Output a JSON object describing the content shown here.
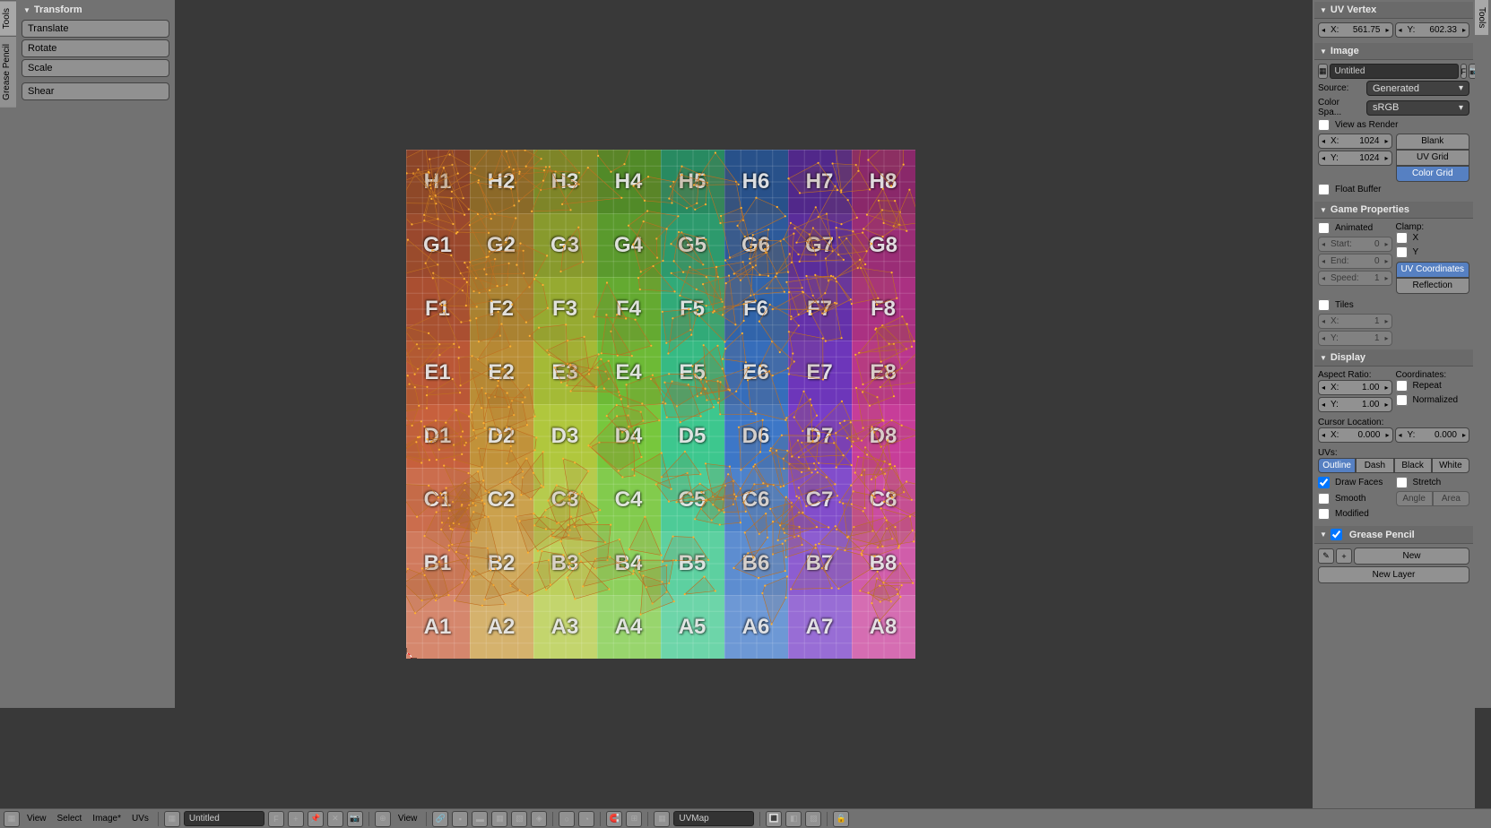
{
  "left_tabs": [
    "Tools",
    "Grease Pencil"
  ],
  "right_tabs": [
    "Tools"
  ],
  "transform": {
    "title": "Transform",
    "buttons": [
      "Translate",
      "Rotate",
      "Scale",
      "Shear"
    ]
  },
  "uv_vertex": {
    "title": "UV Vertex",
    "x": "561.75",
    "y": "602.33"
  },
  "image": {
    "title": "Image",
    "name": "Untitled",
    "f_label": "F",
    "source_label": "Source:",
    "source_value": "Generated",
    "colorspace_label": "Color Spa...",
    "colorspace_value": "sRGB",
    "view_as_render": "View as Render",
    "res_x": "1024",
    "res_y": "1024",
    "gen_types": [
      "Blank",
      "UV Grid",
      "Color Grid"
    ],
    "gen_active": 2,
    "float_buffer": "Float Buffer"
  },
  "game_props": {
    "title": "Game Properties",
    "animated": "Animated",
    "start_label": "Start:",
    "start_value": "0",
    "end_label": "End:",
    "end_value": "0",
    "speed_label": "Speed:",
    "speed_value": "1",
    "clamp_label": "Clamp:",
    "clamp_x": "X",
    "clamp_y": "Y",
    "mapping_types": [
      "UV Coordinates",
      "Reflection"
    ],
    "mapping_active": 0,
    "tiles": "Tiles",
    "tiles_x": "1",
    "tiles_y": "1"
  },
  "display": {
    "title": "Display",
    "aspect_label": "Aspect Ratio:",
    "aspect_x": "1.00",
    "aspect_y": "1.00",
    "coords_label": "Coordinates:",
    "repeat": "Repeat",
    "normalized": "Normalized",
    "cursor_label": "Cursor Location:",
    "cursor_x": "0.000",
    "cursor_y": "0.000",
    "uvs_label": "UVs:",
    "uv_styles": [
      "Outline",
      "Dash",
      "Black",
      "White"
    ],
    "uv_style_active": 0,
    "draw_faces": "Draw Faces",
    "stretch": "Stretch",
    "smooth": "Smooth",
    "stretch_types": [
      "Angle",
      "Area"
    ],
    "modified": "Modified"
  },
  "grease_pencil": {
    "title": "Grease Pencil",
    "new": "New",
    "new_layer": "New Layer"
  },
  "footer": {
    "menus": [
      "View",
      "Select",
      "Image*",
      "UVs"
    ],
    "image_name": "Untitled",
    "f_label": "F",
    "view_label": "View",
    "uv_map": "UVMap"
  },
  "uv_grid": {
    "rows": [
      "H",
      "G",
      "F",
      "E",
      "D",
      "C",
      "B",
      "A"
    ],
    "cols": [
      1,
      2,
      3,
      4,
      5,
      6,
      7,
      8
    ],
    "hues": [
      15,
      40,
      70,
      95,
      155,
      215,
      265,
      320
    ]
  }
}
